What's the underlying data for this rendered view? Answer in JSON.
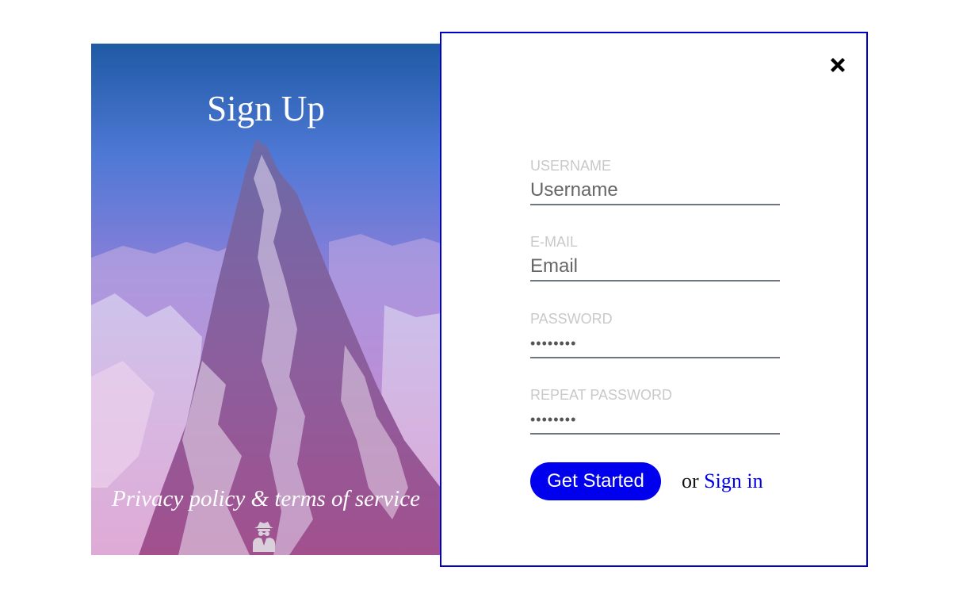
{
  "hero": {
    "title": "Sign Up",
    "privacy_text": "Privacy policy & terms of service",
    "privacy_icon": "user-secret-icon"
  },
  "form": {
    "close_icon": "close-icon",
    "fields": [
      {
        "label": "USERNAME",
        "placeholder": "Username",
        "type": "text",
        "value": ""
      },
      {
        "label": "E-MAIL",
        "placeholder": "Email",
        "type": "email",
        "value": ""
      },
      {
        "label": "PASSWORD",
        "placeholder": "",
        "type": "password",
        "value": "********"
      },
      {
        "label": "REPEAT PASSWORD",
        "placeholder": "",
        "type": "password",
        "value": "********"
      }
    ],
    "submit_label": "Get Started",
    "alt_prefix": "or",
    "alt_link": "Sign in"
  },
  "colors": {
    "accent": "#0000ee",
    "card_border": "#0000cc",
    "label_gray": "#c9c9c9",
    "underline": "#6e7780"
  }
}
